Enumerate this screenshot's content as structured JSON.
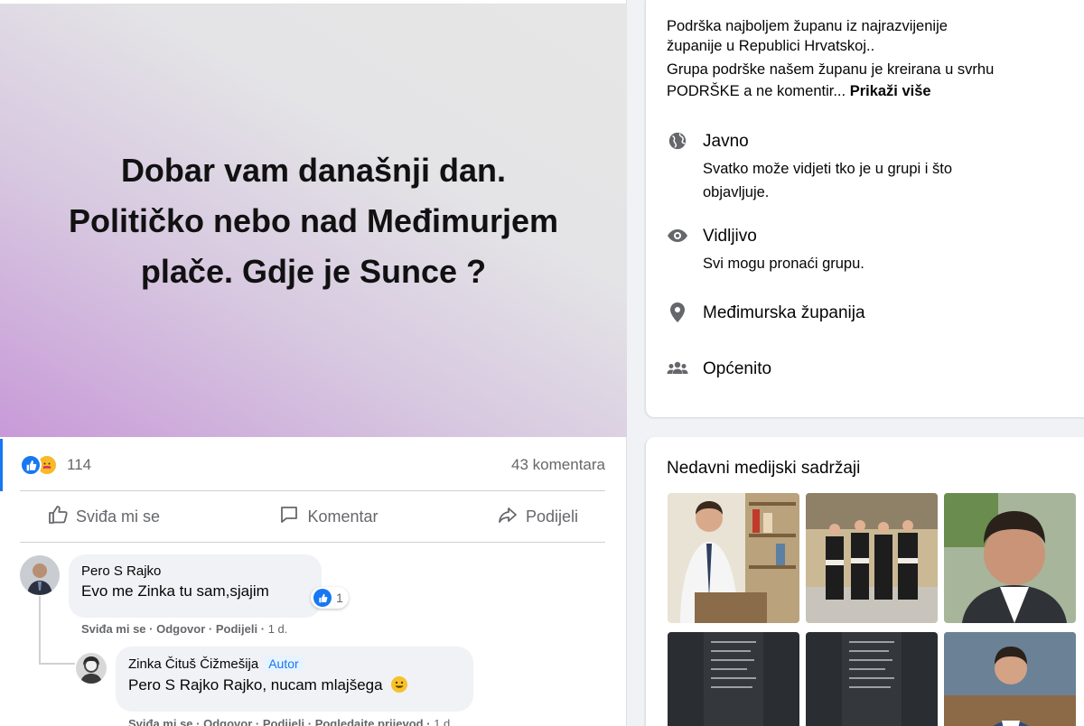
{
  "post": {
    "image_text": "Dobar vam današnji dan. Političko nebo nad Međimurjem plače. Gdje je Sunce ?",
    "reactions_count": "114",
    "comments_count": "43 komentara",
    "actions": {
      "like": "Sviđa mi se",
      "comment": "Komentar",
      "share": "Podijeli"
    }
  },
  "comments": [
    {
      "author": "Pero S Rajko",
      "text": "Evo me Zinka tu sam,sjajim",
      "reaction_count": "1",
      "meta": {
        "like": "Sviđa mi se",
        "reply": "Odgovor",
        "share": "Podijeli",
        "time": "1 d."
      }
    },
    {
      "author": "Zinka Čituš Čižmešija",
      "badge": "Autor",
      "text": "Pero S Rajko Rajko, nucam mlajšega",
      "meta": {
        "like": "Sviđa mi se",
        "reply": "Odgovor",
        "share": "Podijeli",
        "view_translation": "Pogledajte prijevod",
        "time": "1 d."
      }
    }
  ],
  "about": {
    "description_line1": "Podrška najboljem županu iz najrazvijenije",
    "description_line2": "županije u Republici Hrvatskoj..",
    "description_line3": "Grupa podrške našem županu je kreirana u svrhu",
    "description_line4": "PODRŠKE a ne komentir...",
    "show_more": "Prikaži više",
    "items": [
      {
        "icon": "globe-icon",
        "title": "Javno",
        "subtitle_line1": "Svatko može vidjeti tko je u grupi i što",
        "subtitle_line2": "objavljuje."
      },
      {
        "icon": "eye-icon",
        "title": "Vidljivo",
        "subtitle_line1": "Svi mogu pronaći grupu."
      },
      {
        "icon": "location-pin-icon",
        "title": "Međimurska županija"
      },
      {
        "icon": "group-icon",
        "title": "Općenito"
      }
    ]
  },
  "media": {
    "title": "Nedavni medijski sadržaji"
  },
  "colors": {
    "accent": "#1877f2",
    "secondary_text": "#65676b",
    "bubble_bg": "#f0f2f5"
  }
}
